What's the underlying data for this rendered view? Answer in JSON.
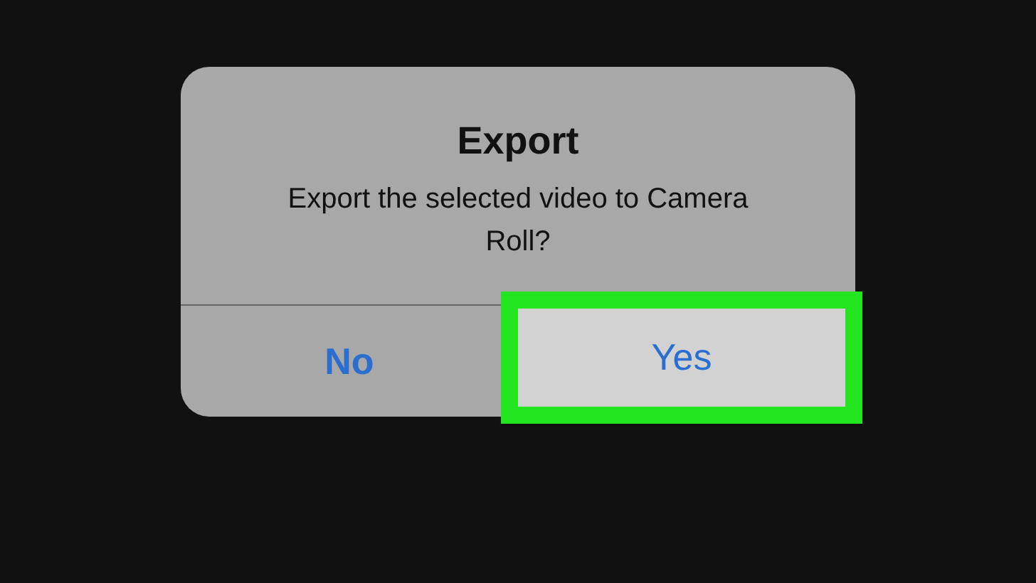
{
  "alert": {
    "title": "Export",
    "message": "Export the selected video to Camera Roll?",
    "buttons": [
      {
        "label": "No",
        "highlighted": false
      },
      {
        "label": "Yes",
        "highlighted": true
      }
    ]
  }
}
